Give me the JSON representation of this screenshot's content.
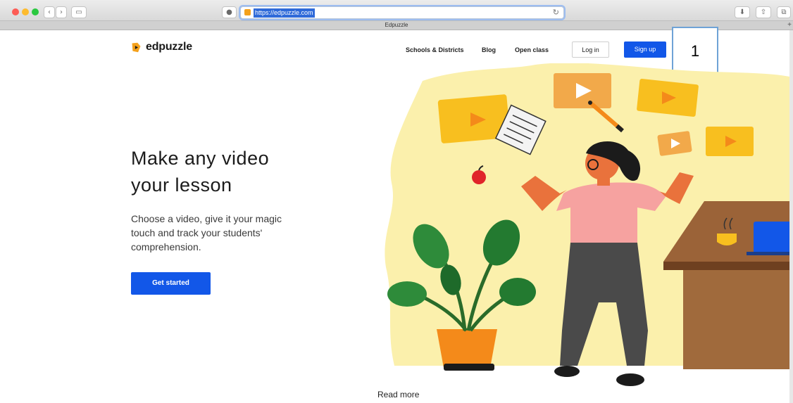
{
  "browser": {
    "url": "https://edpuzzle.com",
    "tab_title": "Edpuzzle",
    "new_tab_symbol": "+",
    "reload_symbol": "↻"
  },
  "site": {
    "logo_text": "edpuzzle",
    "nav": [
      {
        "label": "Schools & Districts"
      },
      {
        "label": "Blog"
      },
      {
        "label": "Open class"
      }
    ],
    "login_label": "Log in",
    "signup_label": "Sign up"
  },
  "hero": {
    "headline_line1": "Make any video",
    "headline_line2": "your lesson",
    "subtext_line1": "Choose a video, give it your magic",
    "subtext_line2": "touch and track your students'",
    "subtext_line3": "comprehension.",
    "cta_label": "Get started"
  },
  "footer": {
    "read_more": "Read more"
  },
  "annotation": {
    "number": "1"
  },
  "colors": {
    "brand_blue": "#1257e8",
    "hero_yellow": "#fbf0ac",
    "video_yellow": "#f8bf1f",
    "video_orange": "#f2a94a",
    "shirt_pink": "#f6a2a0",
    "pants_gray": "#4a4a4a",
    "desk_brown": "#8b5a36"
  },
  "icons": [
    "back-icon",
    "forward-icon",
    "sidebar-icon",
    "shield-icon",
    "download-icon",
    "share-icon",
    "tabs-icon",
    "edpuzzle-logo-icon"
  ]
}
